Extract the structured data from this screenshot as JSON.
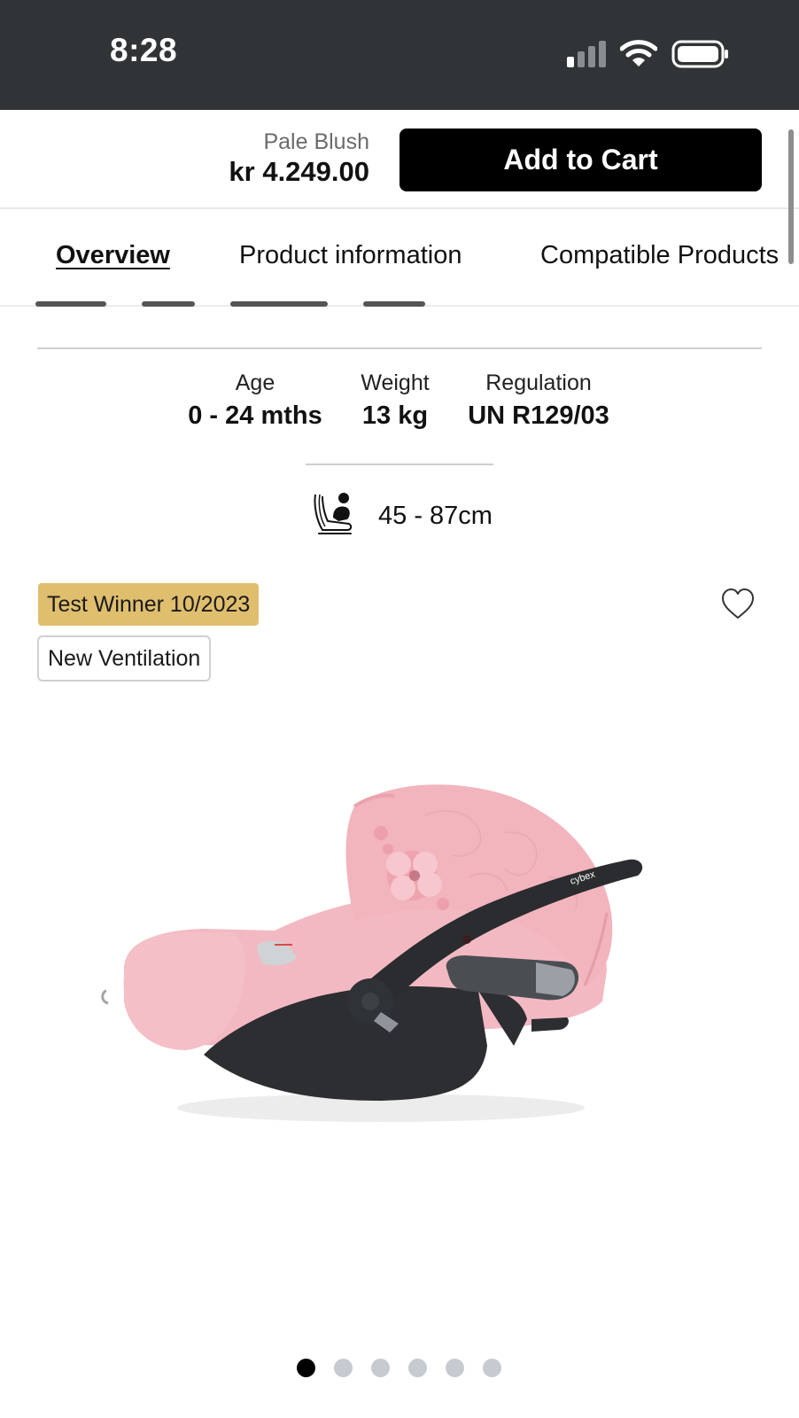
{
  "status_bar": {
    "time": "8:28",
    "icons": [
      "cellular-signal-icon",
      "wifi-icon",
      "battery-icon"
    ]
  },
  "cart_bar": {
    "variant": "Pale Blush",
    "price": "kr 4.249.00",
    "add_to_cart_label": "Add to Cart"
  },
  "tabs": [
    {
      "label": "Overview",
      "active": true
    },
    {
      "label": "Product information",
      "active": false
    },
    {
      "label": "Compatible Products",
      "active": false
    }
  ],
  "specs": [
    {
      "label": "Age",
      "value": "0 - 24 mths"
    },
    {
      "label": "Weight",
      "value": "13 kg"
    },
    {
      "label": "Regulation",
      "value": "UN R129/03"
    }
  ],
  "height_range": {
    "icon": "car-seat-icon",
    "value": "45 - 87cm"
  },
  "badges": {
    "award": "Test Winner 10/2023",
    "feature": "New Ventilation"
  },
  "wishlist": {
    "icon": "heart-icon",
    "selected": false
  },
  "product_image": {
    "brand_text": "cybex"
  },
  "carousel": {
    "total": 6,
    "active_index": 0
  },
  "colors": {
    "status_bar": "#313436",
    "cta": "#000000",
    "award_badge": "#dfbe6e",
    "product_pink": "#f2b6bf",
    "shell_dark": "#2b2d30"
  }
}
